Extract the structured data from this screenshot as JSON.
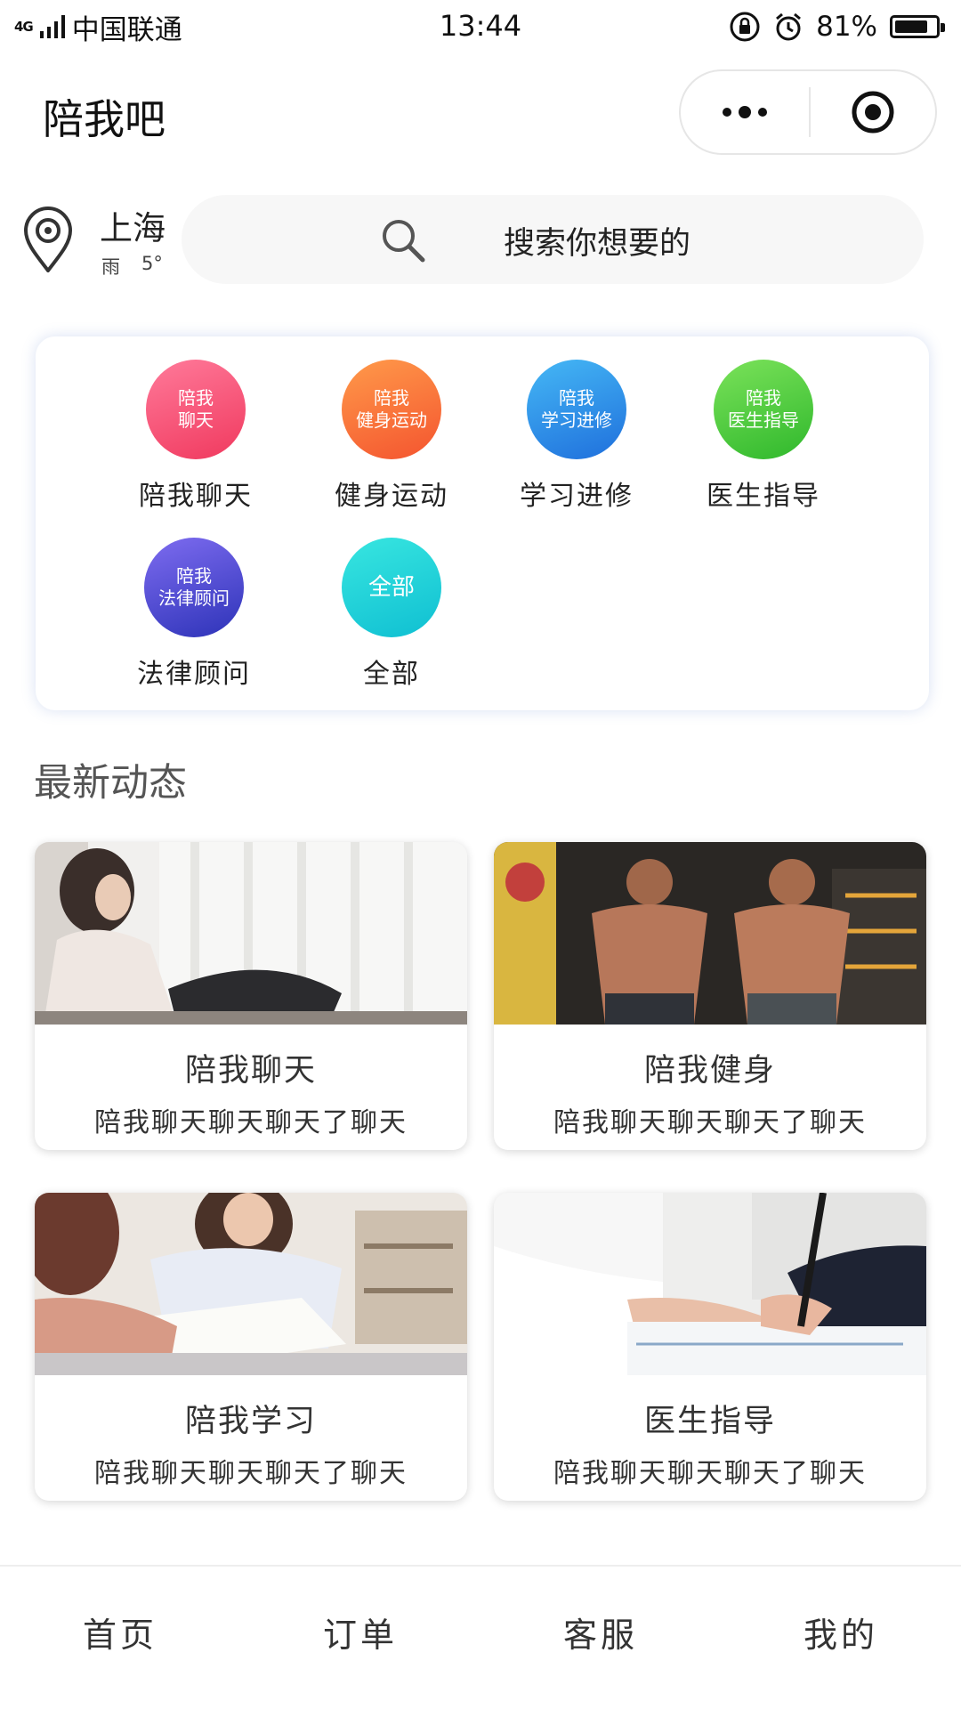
{
  "status_bar": {
    "network": "4G",
    "carrier": "中国联通",
    "time": "13:44",
    "battery": "81%",
    "battery_level": 0.81
  },
  "nav": {
    "app_name": "陪我吧"
  },
  "location": {
    "city": "上海",
    "weather": "雨",
    "temperature": "5°"
  },
  "search": {
    "placeholder": "搜索你想要的"
  },
  "categories": [
    {
      "bubble_line1": "陪我",
      "bubble_line2": "聊天",
      "label": "陪我聊天",
      "gradient": [
        "#ff7a9a",
        "#f0395e"
      ]
    },
    {
      "bubble_line1": "陪我",
      "bubble_line2": "健身运动",
      "label": "健身运动",
      "gradient": [
        "#ff9a4a",
        "#f4542f"
      ]
    },
    {
      "bubble_line1": "陪我",
      "bubble_line2": "学习进修",
      "label": "学习进修",
      "gradient": [
        "#45b8f5",
        "#1f6fdc"
      ]
    },
    {
      "bubble_line1": "陪我",
      "bubble_line2": "医生指导",
      "label": "医生指导",
      "gradient": [
        "#7be25a",
        "#2fb82c"
      ]
    },
    {
      "bubble_line1": "陪我",
      "bubble_line2": "法律顾问",
      "label": "法律顾问",
      "gradient": [
        "#7e6cf0",
        "#2d33b8"
      ]
    },
    {
      "bubble_line1": "全部",
      "bubble_line2": "",
      "label": "全部",
      "gradient": [
        "#38e6e0",
        "#0fbfd2"
      ]
    }
  ],
  "section": {
    "title": "最新动态"
  },
  "posts": [
    {
      "title": "陪我聊天",
      "desc": "陪我聊天聊天聊天了聊天"
    },
    {
      "title": "陪我健身",
      "desc": "陪我聊天聊天聊天了聊天"
    },
    {
      "title": "陪我学习",
      "desc": "陪我聊天聊天聊天了聊天"
    },
    {
      "title": "医生指导",
      "desc": "陪我聊天聊天聊天了聊天"
    }
  ],
  "tabbar": {
    "items": [
      "首页",
      "订单",
      "客服",
      "我的"
    ]
  }
}
